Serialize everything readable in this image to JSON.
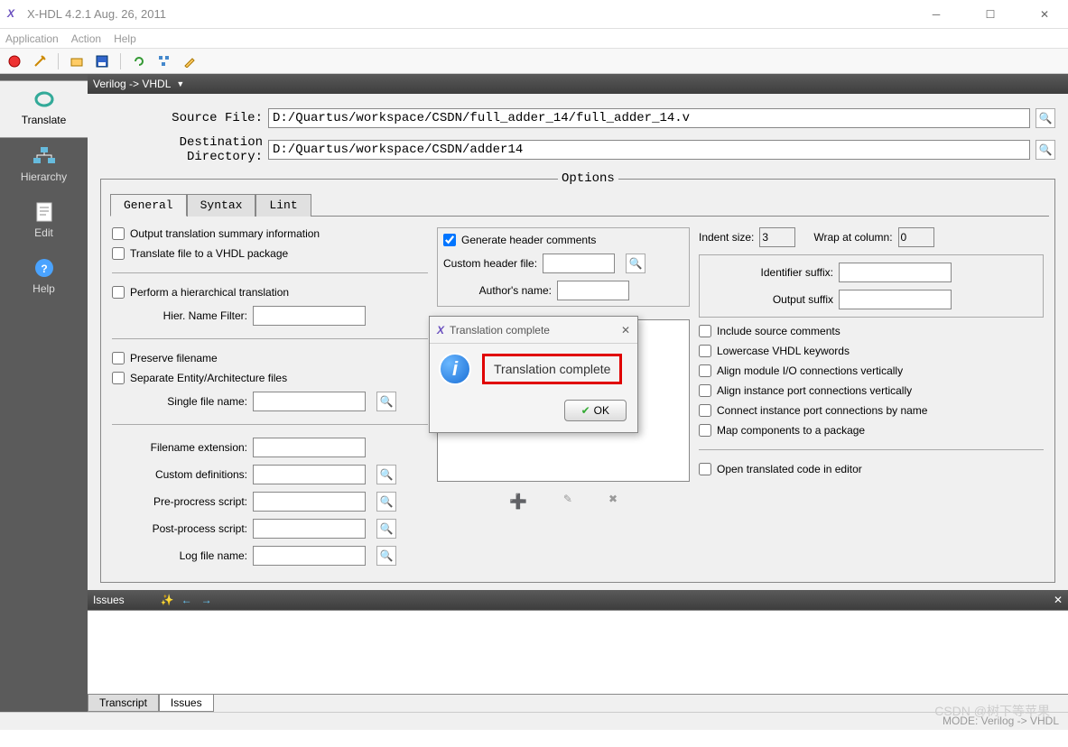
{
  "window": {
    "title": "X-HDL 4.2.1  Aug. 26, 2011"
  },
  "menubar": [
    "Application",
    "Action",
    "Help"
  ],
  "mode": "Verilog -> VHDL",
  "source_file_label": "Source File:",
  "source_file": "D:/Quartus/workspace/CSDN/full_adder_14/full_adder_14.v",
  "dest_dir_label": "Destination Directory:",
  "dest_dir": "D:/Quartus/workspace/CSDN/adder14",
  "options_legend": "Options",
  "tabs": [
    "General",
    "Syntax",
    "Lint"
  ],
  "col1": {
    "chk_summary": "Output translation summary information",
    "chk_pkg": "Translate file to a VHDL package",
    "chk_hier": "Perform a hierarchical translation",
    "hier_filter_label": "Hier. Name Filter:",
    "hier_filter": "",
    "chk_preserve": "Preserve filename",
    "chk_separate": "Separate Entity/Architecture files",
    "single_file_label": "Single file name:",
    "single_file": "",
    "filename_ext_label": "Filename extension:",
    "filename_ext": "",
    "custom_def_label": "Custom definitions:",
    "custom_def": "",
    "pre_script_label": "Pre-procress script:",
    "pre_script": "",
    "post_script_label": "Post-process script:",
    "post_script": "",
    "log_file_label": "Log file name:",
    "log_file": ""
  },
  "col2": {
    "chk_gen_header": "Generate header comments",
    "custom_header_label": "Custom header file:",
    "custom_header": "",
    "author_label": "Author's name:",
    "author": ""
  },
  "col3": {
    "indent_label": "Indent size:",
    "indent_size": "3",
    "wrap_label": "Wrap at column:",
    "wrap_col": "0",
    "ident_suffix_label": "Identifier suffix:",
    "ident_suffix": "",
    "output_suffix_label": "Output suffix",
    "output_suffix": "",
    "chk_include_comments": "Include source comments",
    "chk_lowercase": "Lowercase VHDL keywords",
    "chk_align_io": "Align module I/O connections vertically",
    "chk_align_port": "Align instance port connections vertically",
    "chk_connect_name": "Connect instance port connections by name",
    "chk_map_pkg": "Map components to a package",
    "chk_open_editor": "Open translated code in editor"
  },
  "issues_label": "Issues",
  "bottom_tabs": [
    "Transcript",
    "Issues"
  ],
  "status": "MODE: Verilog -> VHDL",
  "sidebar": [
    {
      "label": "Translate"
    },
    {
      "label": "Hierarchy"
    },
    {
      "label": "Edit"
    },
    {
      "label": "Help"
    }
  ],
  "dialog": {
    "title": "Translation complete",
    "message": "Translation complete",
    "ok": "OK"
  },
  "watermark": "CSDN @树下等苹果"
}
